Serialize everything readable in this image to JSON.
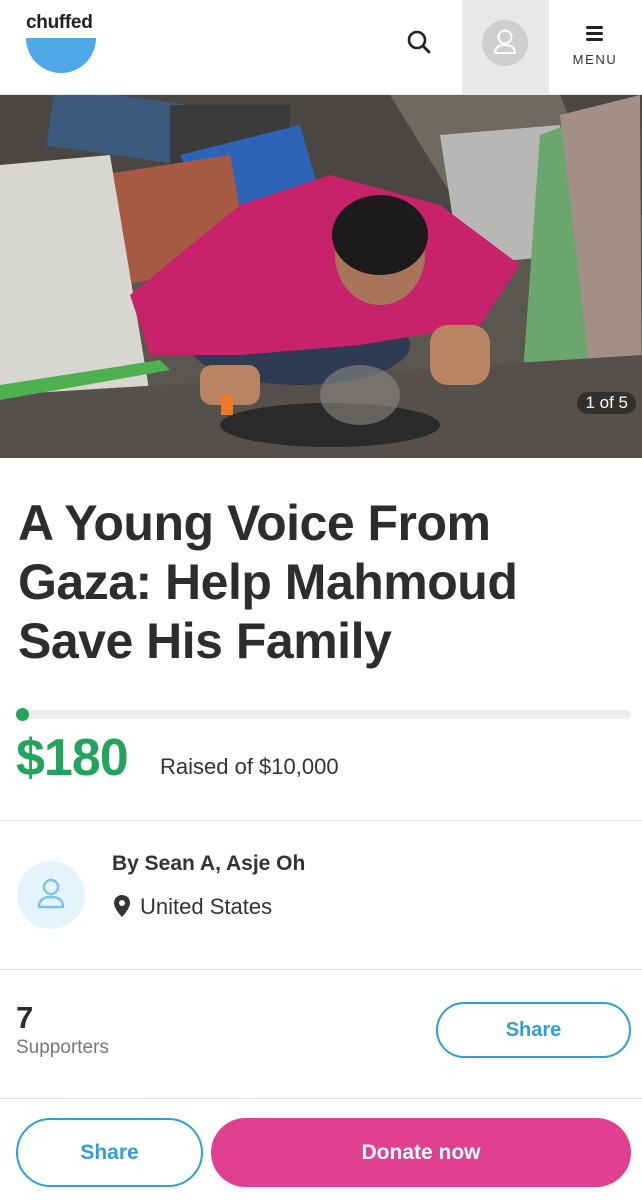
{
  "header": {
    "logo_text": "chuffed",
    "menu_label": "MENU",
    "icons": {
      "search": "search-icon",
      "account": "user-icon",
      "menu": "hamburger-icon"
    }
  },
  "hero": {
    "image_counter": "1 of 5"
  },
  "campaign": {
    "title": "A Young Voice From Gaza: Help Mahmoud Save His Family",
    "raised": "$180",
    "raised_of": "Raised of $10,000",
    "progress_fraction": 0.018
  },
  "organiser": {
    "name": "By Sean A, Asje Oh",
    "location": "United States"
  },
  "supporters": {
    "count": "7",
    "label": "Supporters",
    "share_label": "Share"
  },
  "bottom_bar": {
    "share_label": "Share",
    "donate_label": "Donate now"
  },
  "colors": {
    "accent_green": "#22a45d",
    "accent_blue": "#2f9fd6",
    "donate_pink": "#e0408f",
    "logo_blue": "#4ea9e6"
  }
}
